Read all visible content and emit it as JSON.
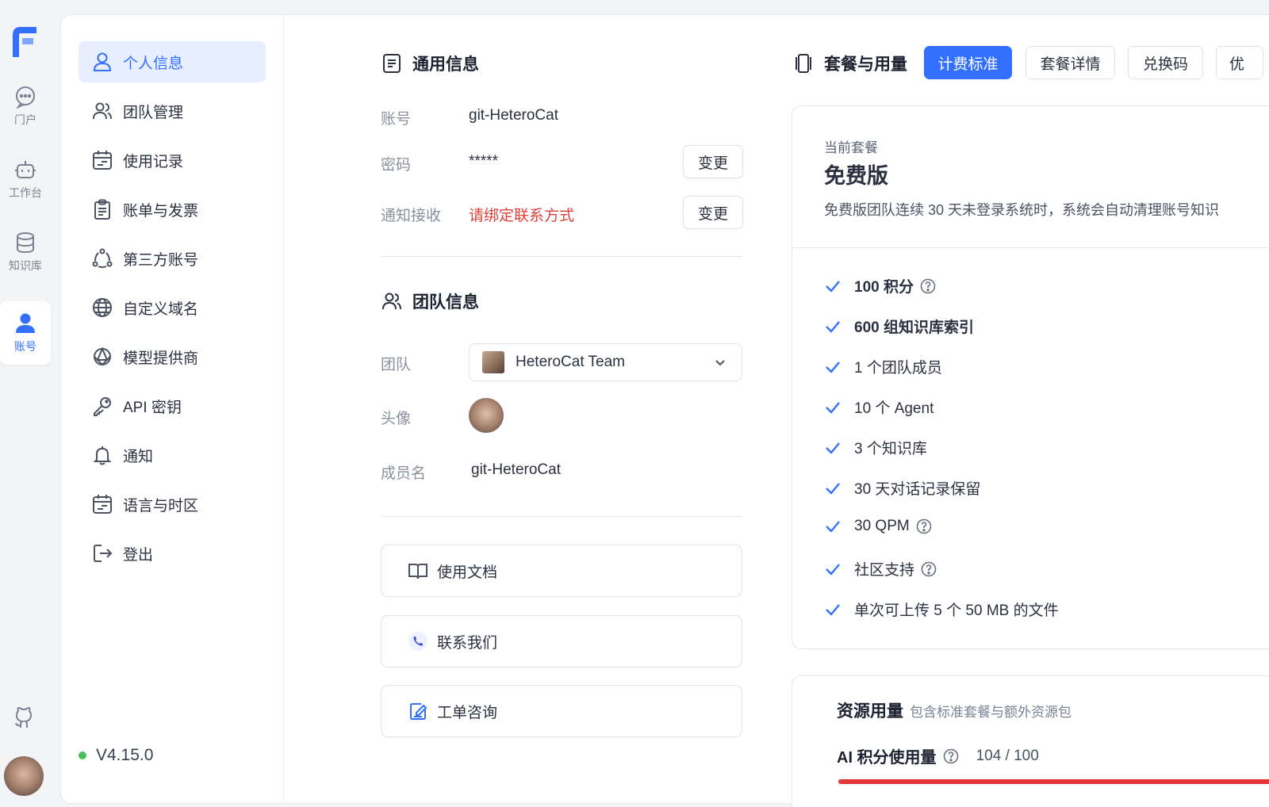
{
  "rail": {
    "items": [
      {
        "label": "门户",
        "icon": "chat-bubble-icon"
      },
      {
        "label": "工作台",
        "icon": "robot-icon"
      },
      {
        "label": "知识库",
        "icon": "database-icon"
      },
      {
        "label": "账号",
        "icon": "user-icon",
        "active": true
      }
    ]
  },
  "sidebar": {
    "items": [
      {
        "label": "个人信息",
        "icon": "user-icon",
        "active": true
      },
      {
        "label": "团队管理",
        "icon": "team-icon"
      },
      {
        "label": "使用记录",
        "icon": "calendar-list-icon"
      },
      {
        "label": "账单与发票",
        "icon": "clipboard-icon"
      },
      {
        "label": "第三方账号",
        "icon": "share-nodes-icon"
      },
      {
        "label": "自定义域名",
        "icon": "globe-icon"
      },
      {
        "label": "模型提供商",
        "icon": "model-icon"
      },
      {
        "label": "API 密钥",
        "icon": "key-icon"
      },
      {
        "label": "通知",
        "icon": "bell-icon"
      },
      {
        "label": "语言与时区",
        "icon": "calendar-list-icon"
      },
      {
        "label": "登出",
        "icon": "logout-icon"
      }
    ],
    "version": "V4.15.0",
    "version_status_color": "#44c05a"
  },
  "general": {
    "title": "通用信息",
    "account_label": "账号",
    "account_value": "git-HeteroCat",
    "password_label": "密码",
    "password_value": "*****",
    "password_button": "变更",
    "notify_label": "通知接收",
    "notify_value": "请绑定联系方式",
    "notify_button": "变更"
  },
  "team": {
    "title": "团队信息",
    "team_label": "团队",
    "team_value": "HeteroCat Team",
    "avatar_label": "头像",
    "member_label": "成员名",
    "member_value": "git-HeteroCat"
  },
  "links": [
    {
      "label": "使用文档",
      "icon": "book-icon"
    },
    {
      "label": "联系我们",
      "icon": "phone-icon"
    },
    {
      "label": "工单咨询",
      "icon": "ticket-edit-icon"
    }
  ],
  "plan": {
    "section_title": "套餐与用量",
    "tabs": [
      {
        "label": "计费标准",
        "primary": true
      },
      {
        "label": "套餐详情"
      },
      {
        "label": "兑换码"
      },
      {
        "label": "优"
      }
    ],
    "current_label": "当前套餐",
    "current_name": "免费版",
    "description": "免费版团队连续 30 天未登录系统时，系统会自动清理账号知识",
    "features": [
      {
        "text": "100 积分",
        "help": true,
        "bold": true
      },
      {
        "text": "600 组知识库索引",
        "help": false,
        "bold": true
      },
      {
        "text": "1 个团队成员",
        "help": false
      },
      {
        "text": "10 个 Agent",
        "help": false
      },
      {
        "text": "3 个知识库",
        "help": false
      },
      {
        "text": "30 天对话记录保留",
        "help": false
      },
      {
        "text": "30 QPM",
        "help": true
      },
      {
        "text": "社区支持",
        "help": true
      },
      {
        "text": "单次可上传 5 个 50 MB 的文件",
        "help": false
      }
    ]
  },
  "usage": {
    "title": "资源用量",
    "subtitle": "包含标准套餐与额外资源包",
    "ai_label": "AI 积分使用量",
    "ai_value": "104 / 100",
    "ai_fraction": 1.0,
    "bar_color": "#e5383b"
  },
  "colors": {
    "accent": "#3370ff",
    "warning": "#e0403a"
  }
}
